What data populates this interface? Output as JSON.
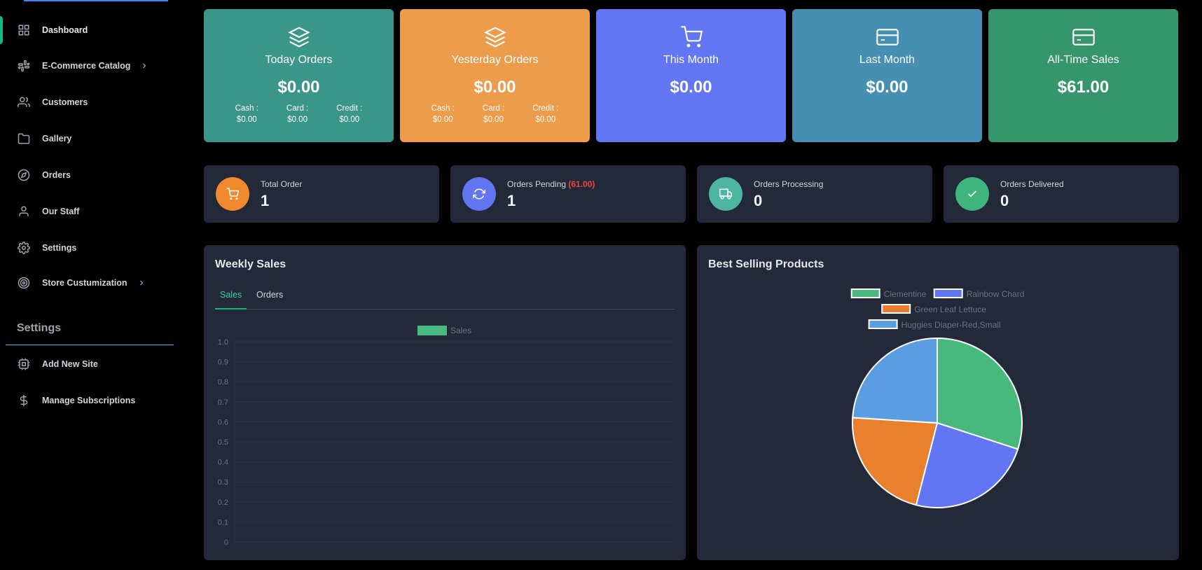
{
  "sidebar": {
    "items": [
      {
        "label": "Dashboard",
        "icon": "grid-icon"
      },
      {
        "label": "E-Commerce Catalog",
        "icon": "slack-icon"
      },
      {
        "label": "Customers",
        "icon": "users-icon"
      },
      {
        "label": "Gallery",
        "icon": "folder-icon"
      },
      {
        "label": "Orders",
        "icon": "compass-icon"
      },
      {
        "label": "Our Staff",
        "icon": "user-icon"
      },
      {
        "label": "Settings",
        "icon": "gear-icon"
      },
      {
        "label": "Store Custumization",
        "icon": "target-icon"
      }
    ],
    "settings_heading": "Settings",
    "settings_items": [
      {
        "label": "Add New Site",
        "icon": "cpu-icon"
      },
      {
        "label": "Manage Subscriptions",
        "icon": "dollar-icon"
      }
    ]
  },
  "top_cards": [
    {
      "title": "Today Orders",
      "value": "$0.00",
      "color": "#3a9688",
      "cash_label": "Cash :",
      "cash": "$0.00",
      "card_label": "Card :",
      "card": "$0.00",
      "credit_label": "Credit :",
      "credit": "$0.00"
    },
    {
      "title": "Yesterday Orders",
      "value": "$0.00",
      "color": "#ed9c4c",
      "cash_label": "Cash :",
      "cash": "$0.00",
      "card_label": "Card :",
      "card": "$0.00",
      "credit_label": "Credit :",
      "credit": "$0.00"
    },
    {
      "title": "This Month",
      "value": "$0.00",
      "color": "#6275f3"
    },
    {
      "title": "Last Month",
      "value": "$0.00",
      "color": "#4590b2"
    },
    {
      "title": "All-Time Sales",
      "value": "$61.00",
      "color": "#35966c"
    }
  ],
  "stats": [
    {
      "label": "Total Order",
      "value": "1",
      "color": "#f08a2c"
    },
    {
      "label": "Orders Pending",
      "extra": "(61.00)",
      "value": "1",
      "color": "#6275f3"
    },
    {
      "label": "Orders Processing",
      "value": "0",
      "color": "#4db6a2"
    },
    {
      "label": "Orders Delivered",
      "value": "0",
      "color": "#3fb47c"
    }
  ],
  "weekly": {
    "title": "Weekly Sales",
    "tabs": [
      "Sales",
      "Orders"
    ]
  },
  "best": {
    "title": "Best Selling Products"
  },
  "chart_data": [
    {
      "type": "bar",
      "legend": [
        "Sales"
      ],
      "series": [
        {
          "name": "Sales",
          "values": []
        }
      ],
      "ylim": [
        0,
        1.0
      ],
      "yticks": [
        "1.0",
        "0.9",
        "0.8",
        "0.7",
        "0.6",
        "0.5",
        "0.4",
        "0.3",
        "0.2",
        "0.1",
        "0"
      ],
      "grid": true,
      "legend_position": "top",
      "color": "#47b97f"
    },
    {
      "type": "pie",
      "categories": [
        "Clementine",
        "Rainbow Chard",
        "Green Leaf Lettuce",
        "Huggies Diaper-Red,Small"
      ],
      "values": [
        30,
        24,
        22,
        24
      ],
      "colors": [
        "#47b97f",
        "#6275f3",
        "#e8802d",
        "#5a9de0"
      ],
      "legend_position": "top"
    }
  ]
}
